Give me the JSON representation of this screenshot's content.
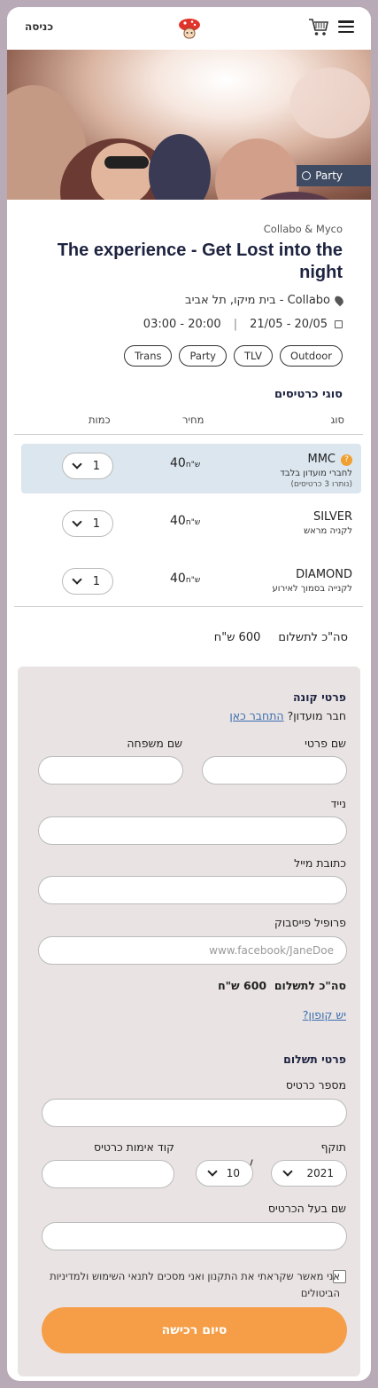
{
  "header": {
    "login_label": "כניסה"
  },
  "hero": {
    "category": "Party"
  },
  "event": {
    "organizer": "Collabo & Myco",
    "title": "The experience - Get Lost into the night",
    "location": "Collabo - בית מיקו, תל אביב",
    "dates": "20/05 - 21/05",
    "times": "20:00 - 03:00",
    "tags": [
      "Outdoor",
      "TLV",
      "Party",
      "Trans"
    ]
  },
  "tickets": {
    "section_title": "סוגי כרטיסים",
    "col_type": "סוג",
    "col_price": "מחיר",
    "col_qty": "כמות",
    "currency": "ש\"ח",
    "rows": [
      {
        "name": "MMC",
        "sub": "לחברי מועדון בלבד",
        "note": "(נותרו 3 כרטיסים)",
        "price": "40",
        "qty": "1"
      },
      {
        "name": "SILVER",
        "sub": "לקניה מראש",
        "note": "",
        "price": "40",
        "qty": "1"
      },
      {
        "name": "DIAMOND",
        "sub": "לקנייה בסמוך לאירוע",
        "note": "",
        "price": "40",
        "qty": "1"
      }
    ],
    "total_label": "סה\"כ לתשלום",
    "total_value": "600 ש\"ח"
  },
  "buyer": {
    "title": "פרטי קונה",
    "member_q": "חבר מועדון?",
    "member_link": "התחבר כאן",
    "first_name": "שם פרטי",
    "last_name": "שם משפחה",
    "mobile": "נייד",
    "email": "כתובת מייל",
    "facebook": "פרופיל פייסבוק",
    "facebook_placeholder": "www.facebook/JaneDoe",
    "total_label": "סה\"כ לתשלום",
    "total_value": "600 ש\"ח",
    "coupon": "יש קופון?"
  },
  "payment": {
    "title": "פרטי תשלום",
    "card_number": "מספר כרטיס",
    "expiry": "תוקף",
    "cvv": "קוד אימות כרטיס",
    "exp_year": "2021",
    "exp_month": "10",
    "holder": "שם בעל הכרטיס",
    "terms": "אני מאשר שקראתי את התקנון ואני מסכים לתנאי השימוש ולמדיניות הביטולים",
    "submit": "סיום רכישה"
  },
  "colors": {
    "accent": "#f59e47",
    "navy": "#1d2340",
    "selected_row": "#dbe6ee",
    "panel": "#e9e3e3"
  }
}
